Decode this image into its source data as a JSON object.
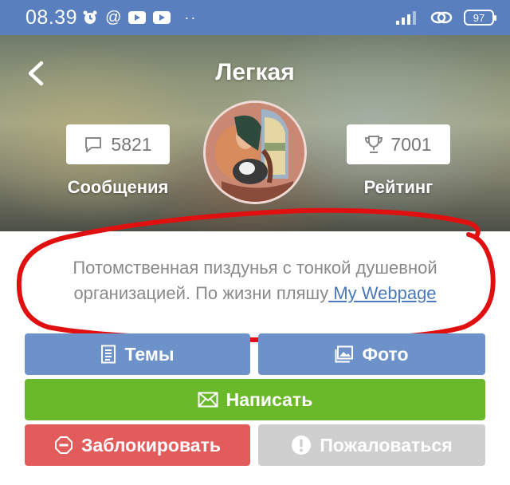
{
  "status_bar": {
    "time": "08.39",
    "at_symbol": "@",
    "more_indicator": "··",
    "battery": "97",
    "icons": [
      "alarm-icon",
      "at-icon",
      "youtube-icon",
      "youtube-icon",
      "signal-icon",
      "link-icon",
      "battery-icon"
    ]
  },
  "header": {
    "title": "Легкая",
    "messages_count": "5821",
    "messages_label": "Сообщения",
    "rating_value": "7001",
    "rating_label": "Рейтинг"
  },
  "bio": {
    "text": "Потомственная пиздунья с тонкой душевной организацией. По жизни пляшу",
    "link_text": " My Webpage"
  },
  "buttons": {
    "topics": "Темы",
    "photo": "Фото",
    "write": "Написать",
    "block": "Заблокировать",
    "report": "Пожаловаться"
  },
  "colors": {
    "status_bar": "#5a7fbf",
    "blue_button": "#6d92c9",
    "green_button": "#6ab92a",
    "red_button": "#e35c5c",
    "gray_button": "#cfcfcf",
    "annotation_ring": "#e01010"
  }
}
